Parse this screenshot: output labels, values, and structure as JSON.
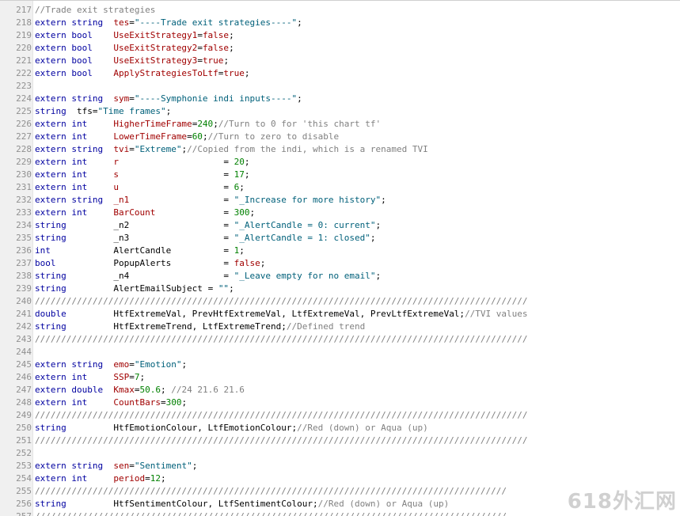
{
  "editor": {
    "lines": [
      {
        "num": "217",
        "tokens": [
          {
            "t": "//Trade exit strategies",
            "c": "cm"
          }
        ]
      },
      {
        "num": "218",
        "tokens": [
          {
            "t": "extern string  ",
            "c": "kw"
          },
          {
            "t": "tes",
            "c": "id"
          },
          {
            "t": "=",
            "c": "pl"
          },
          {
            "t": "\"----Trade exit strategies----\"",
            "c": "str"
          },
          {
            "t": ";",
            "c": "pl"
          }
        ]
      },
      {
        "num": "219",
        "tokens": [
          {
            "t": "extern bool    ",
            "c": "kw"
          },
          {
            "t": "UseExitStrategy1",
            "c": "id"
          },
          {
            "t": "=",
            "c": "pl"
          },
          {
            "t": "false",
            "c": "id"
          },
          {
            "t": ";",
            "c": "pl"
          }
        ]
      },
      {
        "num": "220",
        "tokens": [
          {
            "t": "extern bool    ",
            "c": "kw"
          },
          {
            "t": "UseExitStrategy2",
            "c": "id"
          },
          {
            "t": "=",
            "c": "pl"
          },
          {
            "t": "false",
            "c": "id"
          },
          {
            "t": ";",
            "c": "pl"
          }
        ]
      },
      {
        "num": "221",
        "tokens": [
          {
            "t": "extern bool    ",
            "c": "kw"
          },
          {
            "t": "UseExitStrategy3",
            "c": "id"
          },
          {
            "t": "=",
            "c": "pl"
          },
          {
            "t": "true",
            "c": "id"
          },
          {
            "t": ";",
            "c": "pl"
          }
        ]
      },
      {
        "num": "222",
        "tokens": [
          {
            "t": "extern bool    ",
            "c": "kw"
          },
          {
            "t": "ApplyStrategiesToLtf",
            "c": "id"
          },
          {
            "t": "=",
            "c": "pl"
          },
          {
            "t": "true",
            "c": "id"
          },
          {
            "t": ";",
            "c": "pl"
          }
        ]
      },
      {
        "num": "223",
        "tokens": []
      },
      {
        "num": "224",
        "tokens": [
          {
            "t": "extern string  ",
            "c": "kw"
          },
          {
            "t": "sym",
            "c": "id"
          },
          {
            "t": "=",
            "c": "pl"
          },
          {
            "t": "\"----Symphonie indi inputs----\"",
            "c": "str"
          },
          {
            "t": ";",
            "c": "pl"
          }
        ]
      },
      {
        "num": "225",
        "tokens": [
          {
            "t": "string  ",
            "c": "kw"
          },
          {
            "t": "tfs",
            "c": "pl"
          },
          {
            "t": "=",
            "c": "pl"
          },
          {
            "t": "\"Time frames\"",
            "c": "str"
          },
          {
            "t": ";",
            "c": "pl"
          }
        ]
      },
      {
        "num": "226",
        "tokens": [
          {
            "t": "extern int     ",
            "c": "kw"
          },
          {
            "t": "HigherTimeFrame",
            "c": "id"
          },
          {
            "t": "=",
            "c": "pl"
          },
          {
            "t": "240",
            "c": "num"
          },
          {
            "t": ";",
            "c": "pl"
          },
          {
            "t": "//Turn to 0 for 'this chart tf'",
            "c": "cm"
          }
        ]
      },
      {
        "num": "227",
        "tokens": [
          {
            "t": "extern int     ",
            "c": "kw"
          },
          {
            "t": "LowerTimeFrame",
            "c": "id"
          },
          {
            "t": "=",
            "c": "pl"
          },
          {
            "t": "60",
            "c": "num"
          },
          {
            "t": ";",
            "c": "pl"
          },
          {
            "t": "//Turn to zero to disable",
            "c": "cm"
          }
        ]
      },
      {
        "num": "228",
        "tokens": [
          {
            "t": "extern string  ",
            "c": "kw"
          },
          {
            "t": "tvi",
            "c": "id"
          },
          {
            "t": "=",
            "c": "pl"
          },
          {
            "t": "\"Extreme\"",
            "c": "str"
          },
          {
            "t": ";",
            "c": "pl"
          },
          {
            "t": "//Copied from the indi, which is a renamed TVI",
            "c": "cm"
          }
        ]
      },
      {
        "num": "229",
        "tokens": [
          {
            "t": "extern int     ",
            "c": "kw"
          },
          {
            "t": "r                    ",
            "c": "id"
          },
          {
            "t": "= ",
            "c": "pl"
          },
          {
            "t": "20",
            "c": "num"
          },
          {
            "t": ";",
            "c": "pl"
          }
        ]
      },
      {
        "num": "230",
        "tokens": [
          {
            "t": "extern int     ",
            "c": "kw"
          },
          {
            "t": "s                    ",
            "c": "id"
          },
          {
            "t": "= ",
            "c": "pl"
          },
          {
            "t": "17",
            "c": "num"
          },
          {
            "t": ";",
            "c": "pl"
          }
        ]
      },
      {
        "num": "231",
        "tokens": [
          {
            "t": "extern int     ",
            "c": "kw"
          },
          {
            "t": "u                    ",
            "c": "id"
          },
          {
            "t": "= ",
            "c": "pl"
          },
          {
            "t": "6",
            "c": "num"
          },
          {
            "t": ";",
            "c": "pl"
          }
        ]
      },
      {
        "num": "232",
        "tokens": [
          {
            "t": "extern string  ",
            "c": "kw"
          },
          {
            "t": "_n1                  ",
            "c": "id"
          },
          {
            "t": "= ",
            "c": "pl"
          },
          {
            "t": "\"_Increase for more history\"",
            "c": "str"
          },
          {
            "t": ";",
            "c": "pl"
          }
        ]
      },
      {
        "num": "233",
        "tokens": [
          {
            "t": "extern int     ",
            "c": "kw"
          },
          {
            "t": "BarCount             ",
            "c": "id"
          },
          {
            "t": "= ",
            "c": "pl"
          },
          {
            "t": "300",
            "c": "num"
          },
          {
            "t": ";",
            "c": "pl"
          }
        ]
      },
      {
        "num": "234",
        "tokens": [
          {
            "t": "string         ",
            "c": "kw"
          },
          {
            "t": "_n2                  ",
            "c": "pl"
          },
          {
            "t": "= ",
            "c": "pl"
          },
          {
            "t": "\"_AlertCandle = 0: current\"",
            "c": "str"
          },
          {
            "t": ";",
            "c": "pl"
          }
        ]
      },
      {
        "num": "235",
        "tokens": [
          {
            "t": "string         ",
            "c": "kw"
          },
          {
            "t": "_n3                  ",
            "c": "pl"
          },
          {
            "t": "= ",
            "c": "pl"
          },
          {
            "t": "\"_AlertCandle = 1: closed\"",
            "c": "str"
          },
          {
            "t": ";",
            "c": "pl"
          }
        ]
      },
      {
        "num": "236",
        "tokens": [
          {
            "t": "int            ",
            "c": "kw"
          },
          {
            "t": "AlertCandle          ",
            "c": "pl"
          },
          {
            "t": "= ",
            "c": "pl"
          },
          {
            "t": "1",
            "c": "num"
          },
          {
            "t": ";",
            "c": "pl"
          }
        ]
      },
      {
        "num": "237",
        "tokens": [
          {
            "t": "bool           ",
            "c": "kw"
          },
          {
            "t": "PopupAlerts          ",
            "c": "pl"
          },
          {
            "t": "= ",
            "c": "pl"
          },
          {
            "t": "false",
            "c": "id"
          },
          {
            "t": ";",
            "c": "pl"
          }
        ]
      },
      {
        "num": "238",
        "tokens": [
          {
            "t": "string         ",
            "c": "kw"
          },
          {
            "t": "_n4                  ",
            "c": "pl"
          },
          {
            "t": "= ",
            "c": "pl"
          },
          {
            "t": "\"_Leave empty for no email\"",
            "c": "str"
          },
          {
            "t": ";",
            "c": "pl"
          }
        ]
      },
      {
        "num": "239",
        "tokens": [
          {
            "t": "string         ",
            "c": "kw"
          },
          {
            "t": "AlertEmailSubject ",
            "c": "pl"
          },
          {
            "t": "= ",
            "c": "pl"
          },
          {
            "t": "\"\"",
            "c": "str"
          },
          {
            "t": ";",
            "c": "pl"
          }
        ]
      },
      {
        "num": "240",
        "tokens": [
          {
            "t": "//////////////////////////////////////////////////////////////////////////////////////////////",
            "c": "cm"
          }
        ]
      },
      {
        "num": "241",
        "tokens": [
          {
            "t": "double         ",
            "c": "kw"
          },
          {
            "t": "HtfExtremeVal, PrevHtfExtremeVal, LtfExtremeVal, PrevLtfExtremeVal;",
            "c": "pl"
          },
          {
            "t": "//TVI values",
            "c": "cm"
          }
        ]
      },
      {
        "num": "242",
        "tokens": [
          {
            "t": "string         ",
            "c": "kw"
          },
          {
            "t": "HtfExtremeTrend, LtfExtremeTrend;",
            "c": "pl"
          },
          {
            "t": "//Defined trend",
            "c": "cm"
          }
        ]
      },
      {
        "num": "243",
        "tokens": [
          {
            "t": "//////////////////////////////////////////////////////////////////////////////////////////////",
            "c": "cm"
          }
        ]
      },
      {
        "num": "244",
        "tokens": []
      },
      {
        "num": "245",
        "tokens": [
          {
            "t": "extern string  ",
            "c": "kw"
          },
          {
            "t": "emo",
            "c": "id"
          },
          {
            "t": "=",
            "c": "pl"
          },
          {
            "t": "\"Emotion\"",
            "c": "str"
          },
          {
            "t": ";",
            "c": "pl"
          }
        ]
      },
      {
        "num": "246",
        "tokens": [
          {
            "t": "extern int     ",
            "c": "kw"
          },
          {
            "t": "SSP",
            "c": "id"
          },
          {
            "t": "=",
            "c": "pl"
          },
          {
            "t": "7",
            "c": "num"
          },
          {
            "t": ";",
            "c": "pl"
          }
        ]
      },
      {
        "num": "247",
        "tokens": [
          {
            "t": "extern double  ",
            "c": "kw"
          },
          {
            "t": "Kmax",
            "c": "id"
          },
          {
            "t": "=",
            "c": "pl"
          },
          {
            "t": "50.6",
            "c": "num"
          },
          {
            "t": "; ",
            "c": "pl"
          },
          {
            "t": "//24 21.6 21.6",
            "c": "cm"
          }
        ]
      },
      {
        "num": "248",
        "tokens": [
          {
            "t": "extern int     ",
            "c": "kw"
          },
          {
            "t": "CountBars",
            "c": "id"
          },
          {
            "t": "=",
            "c": "pl"
          },
          {
            "t": "300",
            "c": "num"
          },
          {
            "t": ";",
            "c": "pl"
          }
        ]
      },
      {
        "num": "249",
        "tokens": [
          {
            "t": "//////////////////////////////////////////////////////////////////////////////////////////////",
            "c": "cm"
          }
        ]
      },
      {
        "num": "250",
        "tokens": [
          {
            "t": "string         ",
            "c": "kw"
          },
          {
            "t": "HtfEmotionColour, LtfEmotionColour;",
            "c": "pl"
          },
          {
            "t": "//Red (down) or Aqua (up)",
            "c": "cm"
          }
        ]
      },
      {
        "num": "251",
        "tokens": [
          {
            "t": "//////////////////////////////////////////////////////////////////////////////////////////////",
            "c": "cm"
          }
        ]
      },
      {
        "num": "252",
        "tokens": []
      },
      {
        "num": "253",
        "tokens": [
          {
            "t": "extern string  ",
            "c": "kw"
          },
          {
            "t": "sen",
            "c": "id"
          },
          {
            "t": "=",
            "c": "pl"
          },
          {
            "t": "\"Sentiment\"",
            "c": "str"
          },
          {
            "t": ";",
            "c": "pl"
          }
        ]
      },
      {
        "num": "254",
        "tokens": [
          {
            "t": "extern int     ",
            "c": "kw"
          },
          {
            "t": "period",
            "c": "id"
          },
          {
            "t": "=",
            "c": "pl"
          },
          {
            "t": "12",
            "c": "num"
          },
          {
            "t": ";",
            "c": "pl"
          }
        ]
      },
      {
        "num": "255",
        "tokens": [
          {
            "t": "//////////////////////////////////////////////////////////////////////////////////////////",
            "c": "cm"
          }
        ]
      },
      {
        "num": "256",
        "tokens": [
          {
            "t": "string         ",
            "c": "kw"
          },
          {
            "t": "HtfSentimentColour, LtfSentimentColour;",
            "c": "pl"
          },
          {
            "t": "//Red (down) or Aqua (up)",
            "c": "cm"
          }
        ]
      },
      {
        "num": "257",
        "tokens": [
          {
            "t": "//////////////////////////////////////////////////////////////////////////////////////////",
            "c": "cm"
          }
        ]
      }
    ]
  },
  "watermark": {
    "text": "618外汇网"
  },
  "colors": {
    "keyword": "#0000a0",
    "identifier": "#a00000",
    "number": "#008000",
    "string": "#00607a",
    "comment": "#808080",
    "gutter_bg": "#f0f0f0",
    "line_number": "#909090"
  }
}
